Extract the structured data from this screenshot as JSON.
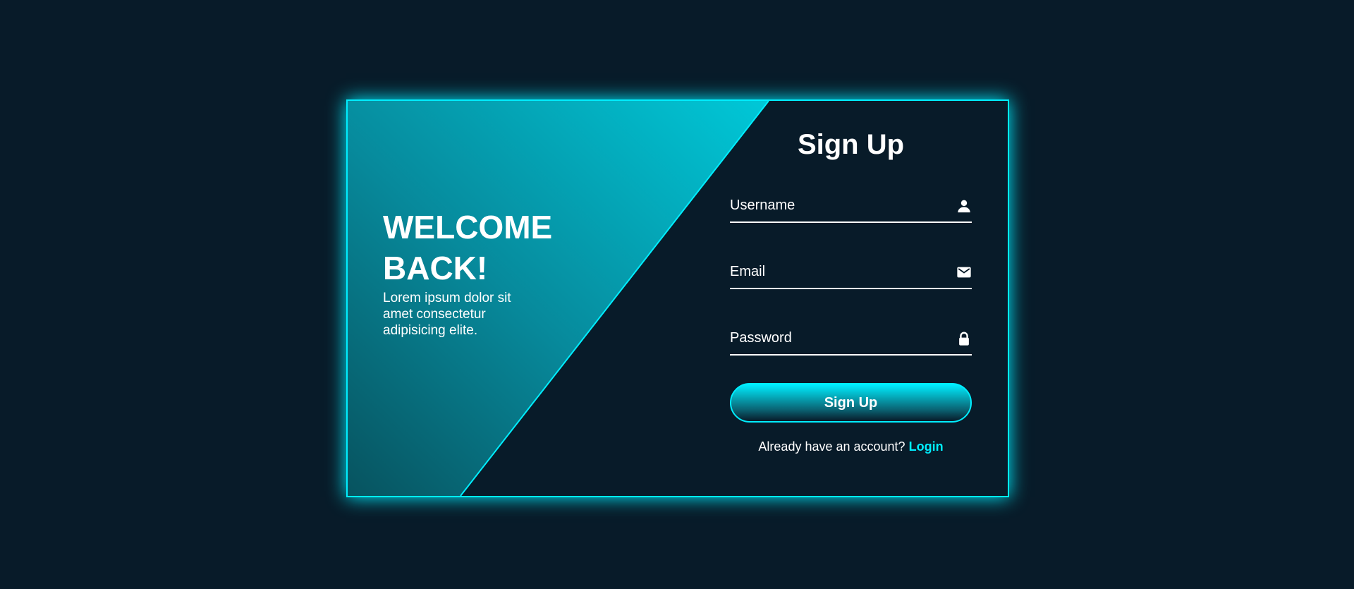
{
  "colors": {
    "background": "#081b29",
    "accent": "#00eeff",
    "text": "#ffffff"
  },
  "welcome": {
    "heading": "WELCOME BACK!",
    "body": "Lorem ipsum dolor sit amet consectetur adipisicing elite."
  },
  "form": {
    "title": "Sign Up",
    "fields": [
      {
        "placeholder": "Username",
        "icon": "user-icon"
      },
      {
        "placeholder": "Email",
        "icon": "envelope-icon"
      },
      {
        "placeholder": "Password",
        "icon": "lock-icon"
      }
    ],
    "submit_label": "Sign Up",
    "footer_text": "Already have an account?",
    "footer_link": "Login"
  }
}
